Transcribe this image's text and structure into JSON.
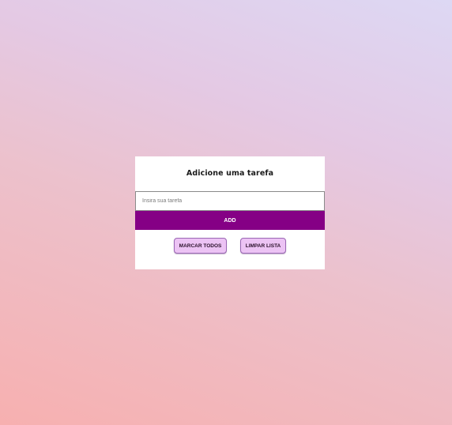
{
  "card": {
    "title": "Adicione uma tarefa",
    "input_placeholder": "Insira sua tarefa",
    "input_value": "",
    "add_label": "ADD",
    "mark_all_label": "MARCAR TODOS",
    "clear_list_label": "LIMPAR LISTA"
  },
  "colors": {
    "add_button": "#850085",
    "pill_button": "#ecc3f4",
    "background_bottom": "#f7b0b0",
    "background_top": "#ddd8f4"
  }
}
